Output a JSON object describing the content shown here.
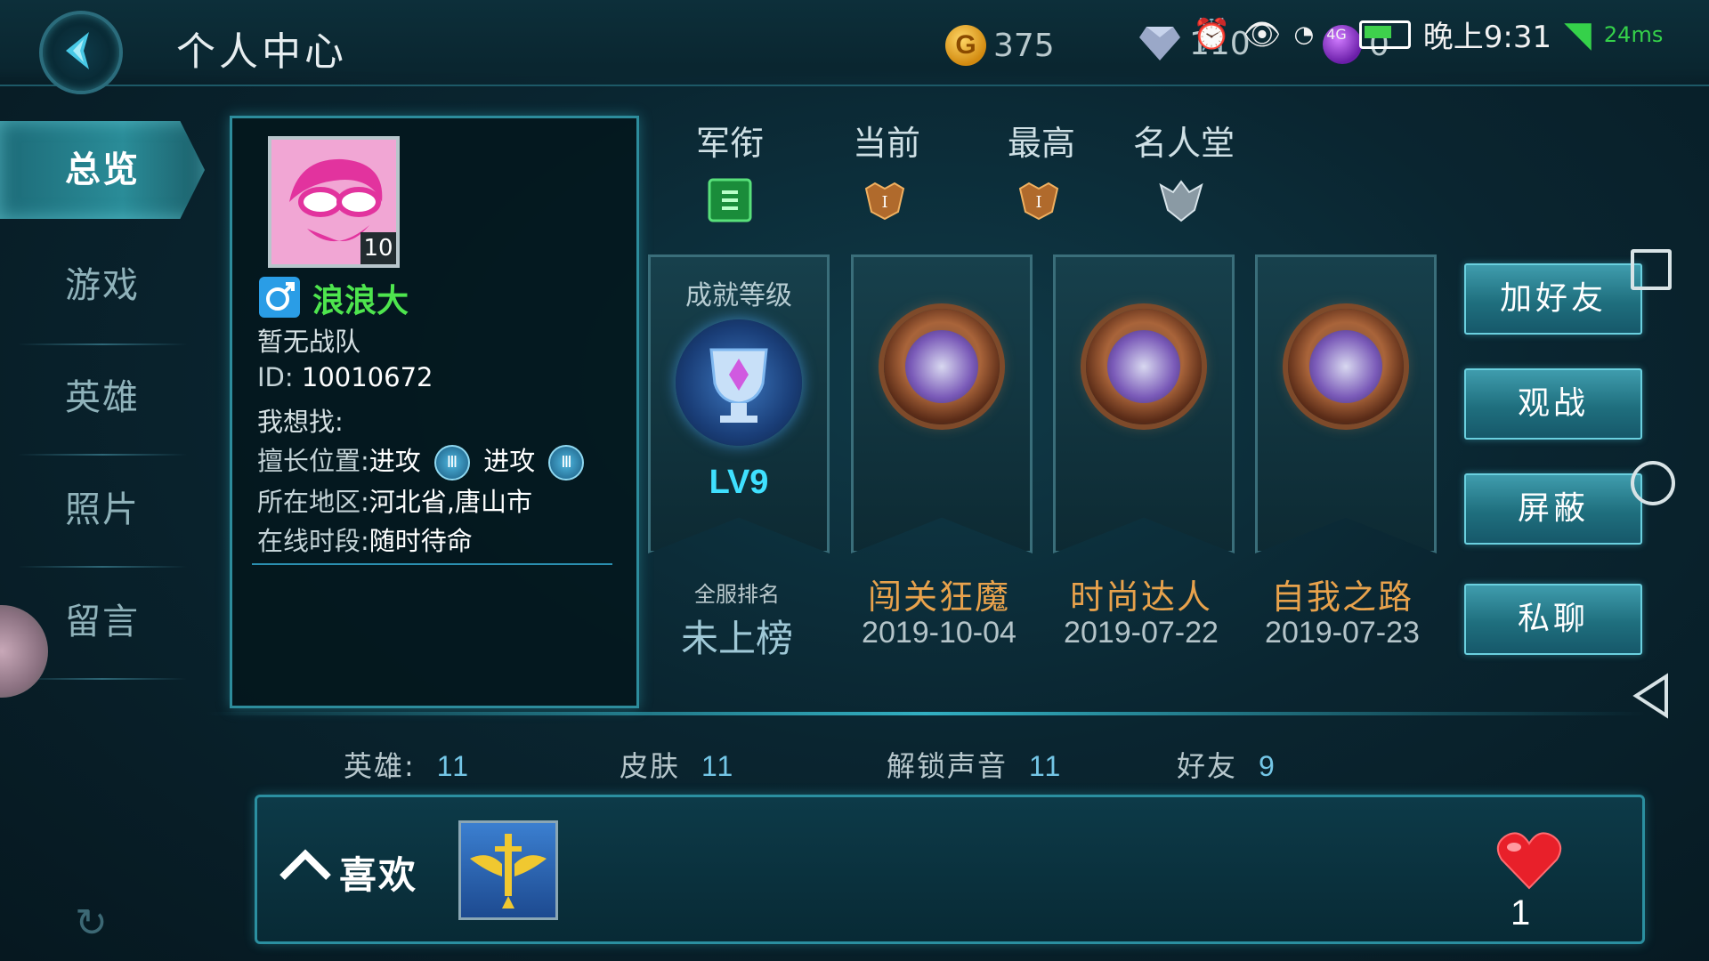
{
  "header": {
    "title": "个人中心",
    "gold": "375",
    "diamond": "110",
    "purple_gem": "0",
    "time": "晚上9:31",
    "network": "4G",
    "ping": "24ms"
  },
  "sidebar": {
    "items": [
      {
        "label": "总览",
        "active": true
      },
      {
        "label": "游戏"
      },
      {
        "label": "英雄"
      },
      {
        "label": "照片"
      },
      {
        "label": "留言"
      }
    ]
  },
  "profile": {
    "avatar_level": "10",
    "nickname": "浪浪大",
    "team": "暂无战队",
    "id_label": "ID:",
    "id_value": "10010672",
    "seeking_label": "我想找:",
    "position_label": "擅长位置:",
    "position_1": "进攻",
    "position_2": "进攻",
    "region_label": "所在地区:",
    "region_value": "河北省,唐山市",
    "online_label": "在线时段:",
    "online_value": "随时待命"
  },
  "ranks": {
    "headers": [
      "军衔",
      "当前",
      "最高",
      "名人堂"
    ]
  },
  "achievement_level": {
    "title": "成就等级",
    "level": "LV9",
    "rank_label": "全服排名",
    "rank_value": "未上榜"
  },
  "achievements": [
    {
      "name": "闯关狂魔",
      "date": "2019-10-04"
    },
    {
      "name": "时尚达人",
      "date": "2019-07-22"
    },
    {
      "name": "自我之路",
      "date": "2019-07-23"
    }
  ],
  "actions": {
    "add_friend": "加好友",
    "spectate": "观战",
    "block": "屏蔽",
    "private_chat": "私聊"
  },
  "stats": {
    "heroes_label": "英雄:",
    "heroes_value": "11",
    "skins_label": "皮肤",
    "skins_value": "11",
    "voices_label": "解锁声音",
    "voices_value": "11",
    "friends_label": "好友",
    "friends_value": "9"
  },
  "likes": {
    "label": "喜欢",
    "count": "1"
  },
  "colors": {
    "accent": "#2d8c9c",
    "nickname": "#4ee54e",
    "achievement_name": "#e8a24c",
    "level": "#3fe0ff"
  }
}
